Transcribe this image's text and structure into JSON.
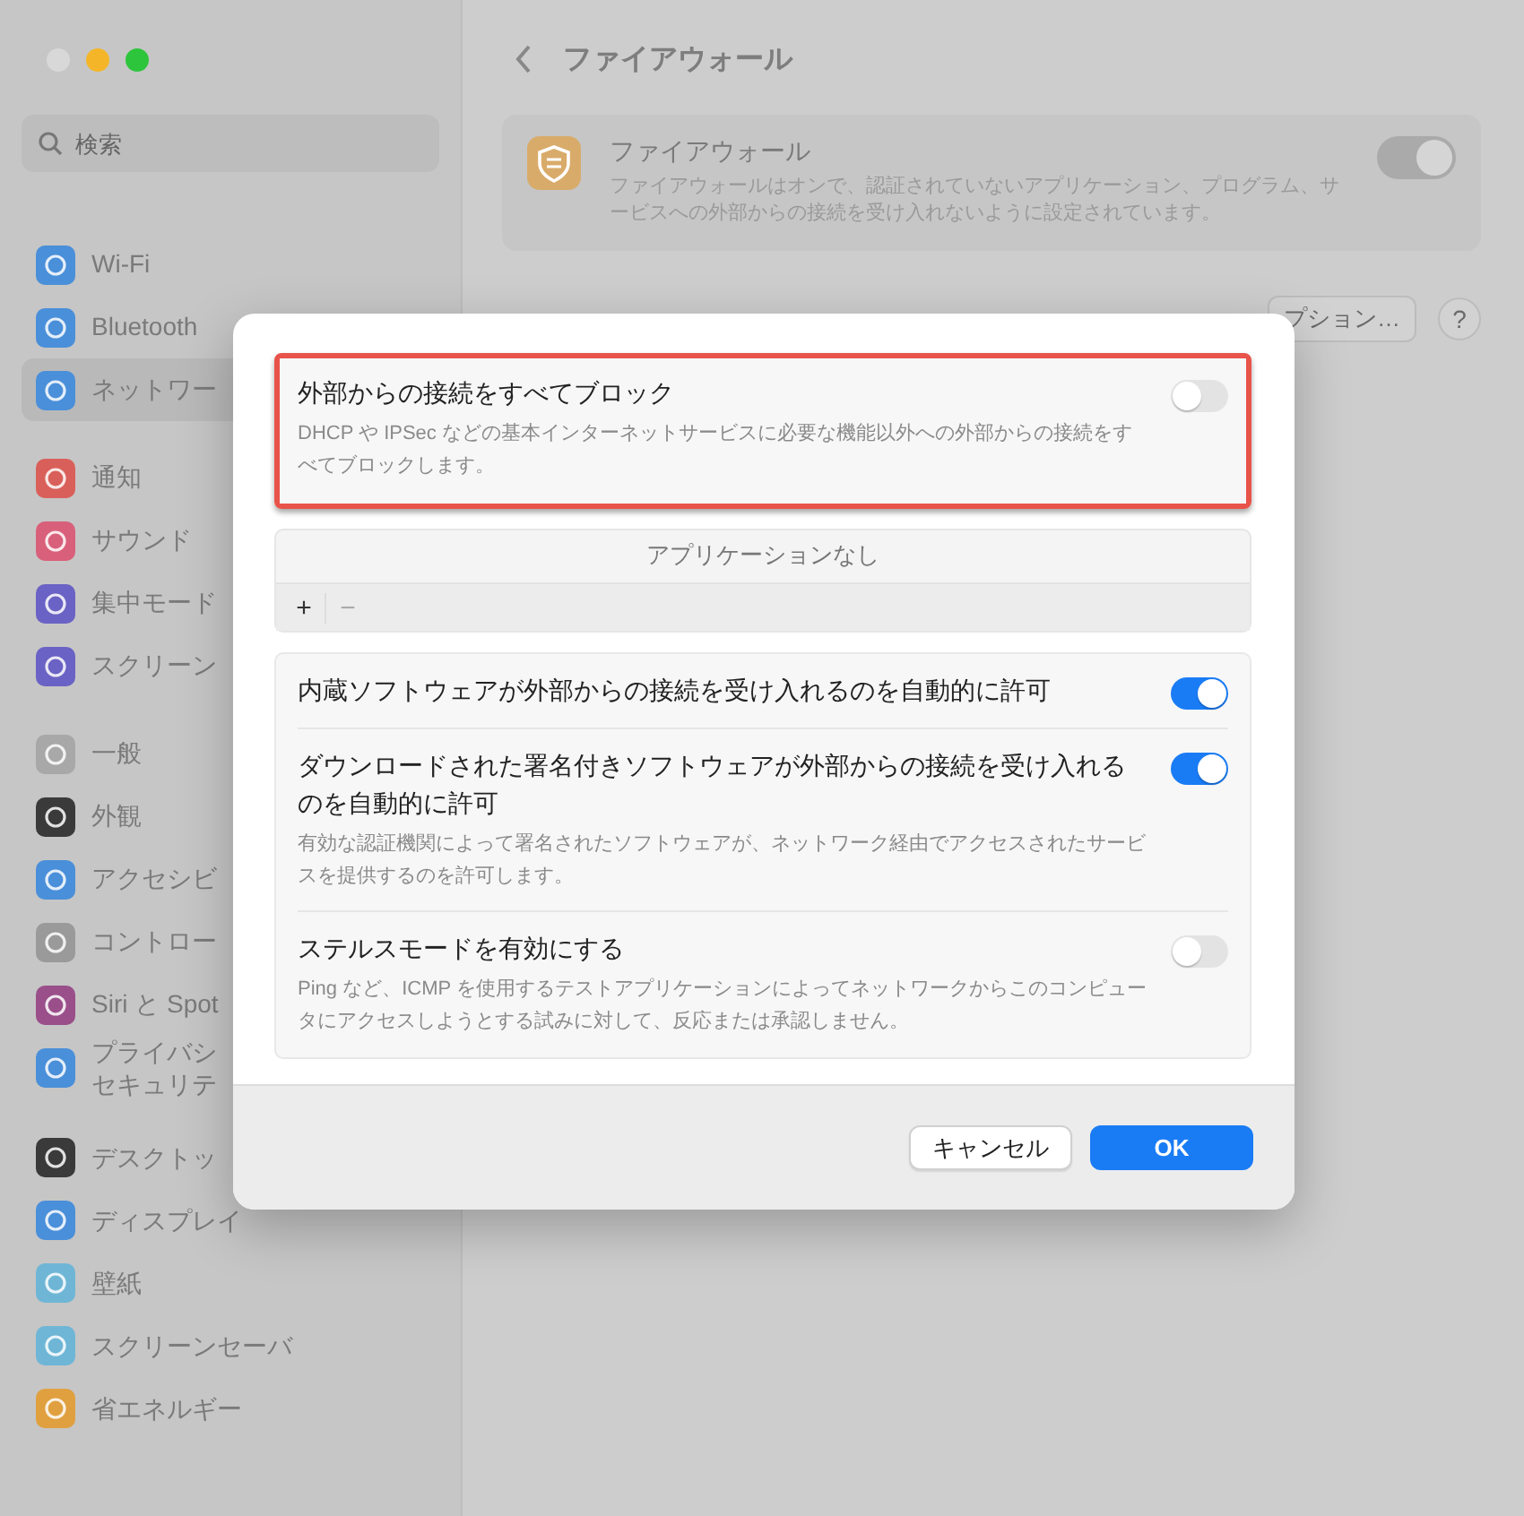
{
  "sidebar": {
    "search": {
      "placeholder": "検索"
    },
    "groups": [
      [
        {
          "label": "Wi-Fi",
          "color": "#4a8fd9",
          "selected": false
        },
        {
          "label": "Bluetooth",
          "color": "#4a8fd9",
          "selected": false
        },
        {
          "label": "ネットワー",
          "color": "#4a8fd9",
          "selected": true
        }
      ],
      [
        {
          "label": "通知",
          "color": "#d9605a",
          "selected": false
        },
        {
          "label": "サウンド",
          "color": "#d9607a",
          "selected": false
        },
        {
          "label": "集中モード",
          "color": "#6a62c4",
          "selected": false
        },
        {
          "label": "スクリーン",
          "color": "#6a62c4",
          "selected": false
        }
      ],
      [
        {
          "label": "一般",
          "color": "#a8a8a8",
          "selected": false
        },
        {
          "label": "外観",
          "color": "#3a3a3a",
          "selected": false
        },
        {
          "label": "アクセシビ",
          "color": "#4a8fd9",
          "selected": false
        },
        {
          "label": "コントロー",
          "color": "#9a9a9a",
          "selected": false
        },
        {
          "label": "Siri と Spot",
          "color": "#9a4f8a",
          "selected": false
        },
        {
          "label": "プライバシ",
          "label_2": "セキュリテ",
          "color": "#4a8fd9",
          "selected": false
        }
      ],
      [
        {
          "label": "デスクトッ",
          "color": "#3a3a3a",
          "selected": false
        },
        {
          "label": "ディスプレイ",
          "color": "#4a8fd9",
          "selected": false
        },
        {
          "label": "壁紙",
          "color": "#6fb6d6",
          "selected": false
        },
        {
          "label": "スクリーンセーバ",
          "color": "#6fb6d6",
          "selected": false
        },
        {
          "label": "省エネルギー",
          "color": "#e0a040",
          "selected": false
        }
      ]
    ]
  },
  "header": {
    "title": "ファイアウォール"
  },
  "firewall": {
    "title": "ファイアウォール",
    "description": "ファイアウォールはオンで、認証されていないアプリケーション、プログラム、サービスへの外部からの接続を受け入れないように設定されています。",
    "on": true
  },
  "options_button": "プション…",
  "help_button": "?",
  "dialog": {
    "block_all": {
      "title": "外部からの接続をすべてブロック",
      "description": "DHCP や IPSec などの基本インターネットサービスに必要な機能以外への外部からの接続をすべてブロックします。",
      "on": false,
      "highlighted": true
    },
    "app_list": {
      "empty_text": "アプリケーションなし",
      "add": "+",
      "remove": "−"
    },
    "options": [
      {
        "title": "内蔵ソフトウェアが外部からの接続を受け入れるのを自動的に許可",
        "on": true
      },
      {
        "title": "ダウンロードされた署名付きソフトウェアが外部からの接続を受け入れるのを自動的に許可",
        "description": "有効な認証機関によって署名されたソフトウェアが、ネットワーク経由でアクセスされたサービスを提供するのを許可します。",
        "on": true
      },
      {
        "title": "ステルスモードを有効にする",
        "description": "Ping など、ICMP を使用するテストアプリケーションによってネットワークからこのコンピュータにアクセスしようとする試みに対して、反応または承認しません。",
        "on": false
      }
    ],
    "buttons": [
      {
        "label": "キャンセル",
        "kind": "secondary"
      },
      {
        "label": "OK",
        "kind": "primary"
      }
    ]
  }
}
